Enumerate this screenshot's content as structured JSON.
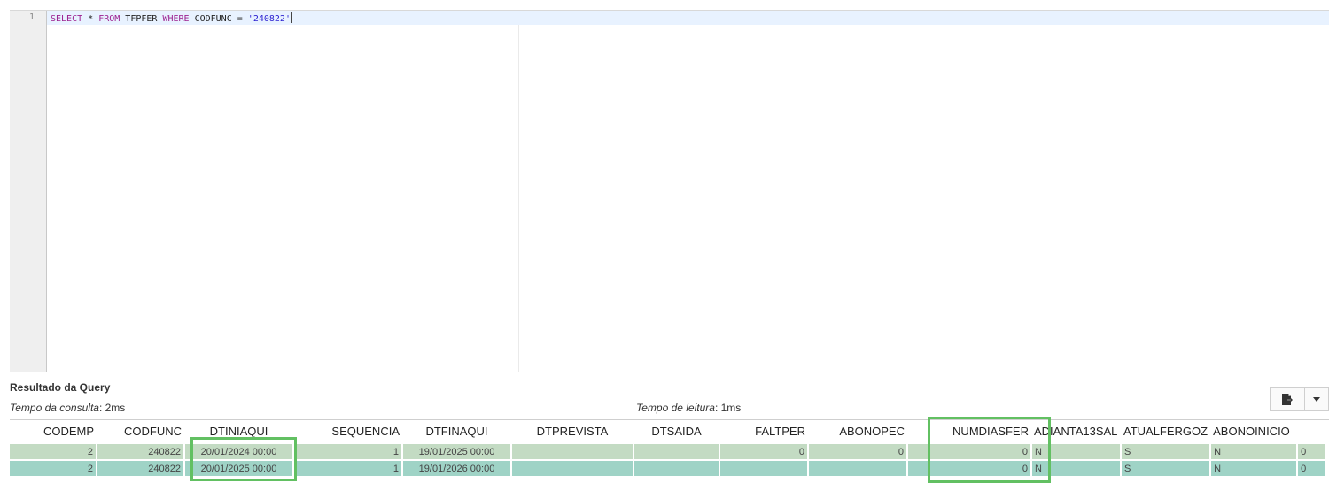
{
  "editor": {
    "line_number": "1",
    "code": {
      "select": "SELECT",
      "star": " * ",
      "from": "FROM",
      "table": " TFPFER ",
      "where": "WHERE",
      "column": " CODFUNC = ",
      "value": "'240822'"
    }
  },
  "results": {
    "title": "Resultado da Query",
    "query_time_label": "Tempo da consulta",
    "query_time_value": ": 2ms",
    "read_time_label": "Tempo de leitura",
    "read_time_value": ": 1ms",
    "export_icon": "export-file-icon",
    "dropdown_icon": "caret-down-icon",
    "columns": [
      "CODEMP",
      "CODFUNC",
      "DTINIAQUI",
      "SEQUENCIA",
      "DTFINAQUI",
      "DTPREVISTA",
      "DTSAIDA",
      "FALTPER",
      "ABONOPEC",
      "NUMDIASFER",
      "ADIANTA13SAL",
      "ATUALFERGOZ",
      "ABONOINICIO",
      ""
    ],
    "rows": [
      [
        "2",
        "240822",
        "20/01/2024 00:00",
        "1",
        "19/01/2025 00:00",
        "",
        "",
        "0",
        "0",
        "0",
        "N",
        "S",
        "N",
        "0"
      ],
      [
        "2",
        "240822",
        "20/01/2025 00:00",
        "1",
        "19/01/2026 00:00",
        "",
        "",
        "",
        "",
        "0",
        "N",
        "S",
        "N",
        "0"
      ]
    ],
    "colors": {
      "row_even": "#c3dbc3",
      "row_odd": "#9fd3c6",
      "highlight": "#62c062",
      "active_line": "#e8f2ff"
    }
  }
}
